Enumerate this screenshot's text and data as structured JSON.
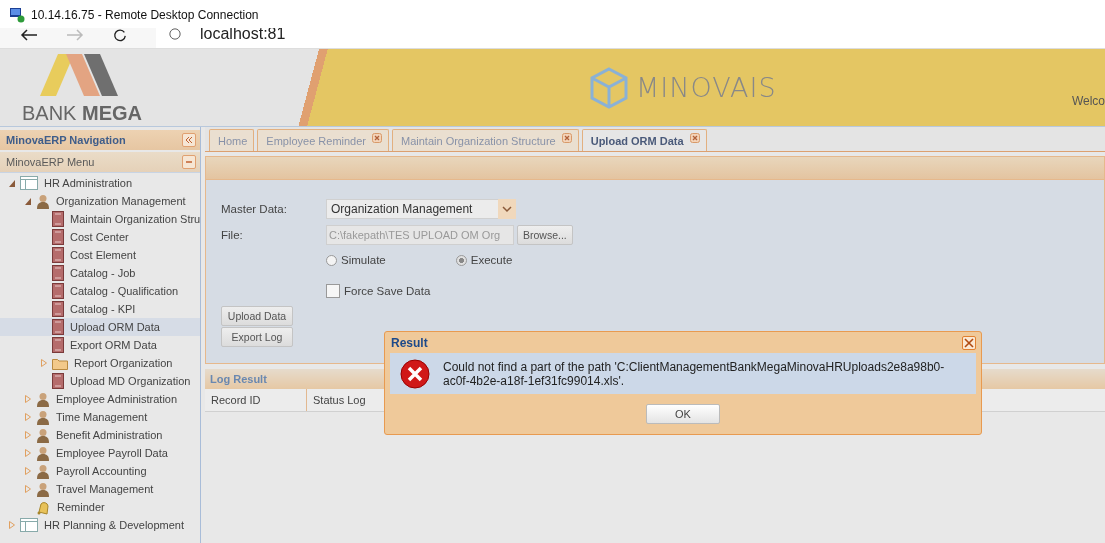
{
  "window": {
    "title": "10.14.16.75 - Remote Desktop Connection"
  },
  "browser": {
    "address": "localhost:81"
  },
  "header": {
    "bank_logo": "BANK **MEGA**",
    "app_logo": "MINOVAIS",
    "welcome": "Welco"
  },
  "sidebar": {
    "title": "MinovaERP Navigation",
    "menu_title": "MinovaERP Menu",
    "tree": [
      {
        "label": "HR Administration",
        "kind": "module",
        "expanded": true,
        "selected": false,
        "children": [
          {
            "label": "Organization Management",
            "kind": "person",
            "expanded": true,
            "selected": false,
            "children": [
              {
                "label": "Maintain Organization Stru",
                "kind": "page",
                "selected": false
              },
              {
                "label": "Cost Center",
                "kind": "page",
                "selected": false
              },
              {
                "label": "Cost Element",
                "kind": "page",
                "selected": false
              },
              {
                "label": "Catalog - Job",
                "kind": "page",
                "selected": false
              },
              {
                "label": "Catalog - Qualification",
                "kind": "page",
                "selected": false
              },
              {
                "label": "Catalog - KPI",
                "kind": "page",
                "selected": false
              },
              {
                "label": "Upload ORM Data",
                "kind": "page",
                "selected": true
              },
              {
                "label": "Export ORM Data",
                "kind": "page",
                "selected": false
              },
              {
                "label": "Report Organization",
                "kind": "folder",
                "expanded": false,
                "selected": false
              },
              {
                "label": "Upload MD Organization",
                "kind": "page",
                "selected": false
              }
            ]
          },
          {
            "label": "Employee Administration",
            "kind": "person",
            "expanded": false,
            "selected": false
          },
          {
            "label": "Time Management",
            "kind": "person",
            "expanded": false,
            "selected": false
          },
          {
            "label": "Benefit Administration",
            "kind": "person",
            "expanded": false,
            "selected": false
          },
          {
            "label": "Employee Payroll Data",
            "kind": "person",
            "expanded": false,
            "selected": false
          },
          {
            "label": "Payroll Accounting",
            "kind": "person",
            "expanded": false,
            "selected": false
          },
          {
            "label": "Travel Management",
            "kind": "person",
            "expanded": false,
            "selected": false
          },
          {
            "label": "Reminder",
            "kind": "bell",
            "selected": false
          }
        ]
      },
      {
        "label": "HR Planning & Development",
        "kind": "module",
        "expanded": false,
        "selected": false
      }
    ]
  },
  "tabs": [
    {
      "label": "Home",
      "closable": false,
      "selected": false
    },
    {
      "label": "Employee Reminder",
      "closable": true,
      "selected": false
    },
    {
      "label": "Maintain Organization Structure",
      "closable": true,
      "selected": false
    },
    {
      "label": "Upload ORM Data",
      "closable": true,
      "selected": true
    }
  ],
  "form": {
    "master_data": {
      "label": "Master Data:",
      "value": "Organization Management"
    },
    "file": {
      "label": "File:",
      "value": "C:\\fakepath\\TES UPLOAD OM Org",
      "button": "Browse..."
    },
    "mode": [
      {
        "label": "Simulate",
        "selected": false
      },
      {
        "label": "Execute",
        "selected": true
      }
    ],
    "force_save": {
      "label": "Force Save Data",
      "checked": false
    },
    "buttons": [
      "Upload Data",
      "Export Log"
    ]
  },
  "log": {
    "title": "Log Result",
    "columns": [
      "Record ID",
      "Status Log"
    ]
  },
  "dialog": {
    "title": "Result",
    "message": "Could not find a part of the path 'C:ClientManagementBankMegaMinovaHRUploads2e8a98b0-ac0f-4b2e-a18f-1ef31fc99014.xls'.",
    "button": "OK"
  }
}
